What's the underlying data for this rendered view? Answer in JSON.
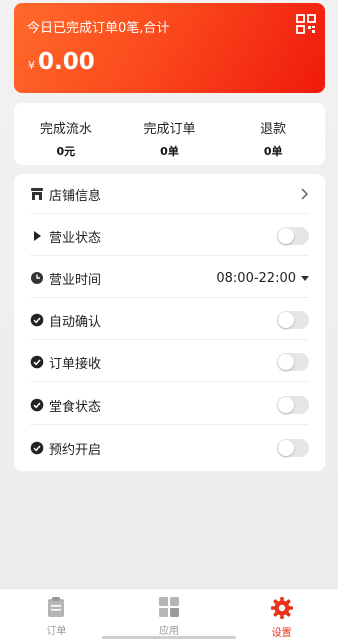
{
  "summary": {
    "title": "今日已完成订单0笔,合计",
    "currency": "¥",
    "amount": "0.00"
  },
  "stats": [
    {
      "label": "完成流水",
      "value": "0元"
    },
    {
      "label": "完成订单",
      "value": "0单"
    },
    {
      "label": "退款",
      "value": "0单"
    }
  ],
  "settings": {
    "store_info": "店铺信息",
    "business_status": "营业状态",
    "business_hours": "营业时间",
    "business_hours_value": "08:00-22:00",
    "auto_confirm": "自动确认",
    "order_receive": "订单接收",
    "dine_in_status": "堂食状态",
    "reservation": "预约开启"
  },
  "toggles": {
    "business_status": false,
    "auto_confirm": false,
    "order_receive": false,
    "dine_in_status": false,
    "reservation": false
  },
  "tabbar": {
    "orders": "订单",
    "apps": "应用",
    "settings": "设置"
  },
  "colors": {
    "accent": "#e8321a",
    "hero_start": "#ff6a2b",
    "hero_end": "#f0190d"
  },
  "icons": [
    "qr-code-icon",
    "store-icon",
    "play-icon",
    "clock-icon",
    "check-circle-icon",
    "chevron-right-icon",
    "caret-down-icon",
    "clipboard-icon",
    "grid-apps-icon",
    "gear-icon"
  ]
}
